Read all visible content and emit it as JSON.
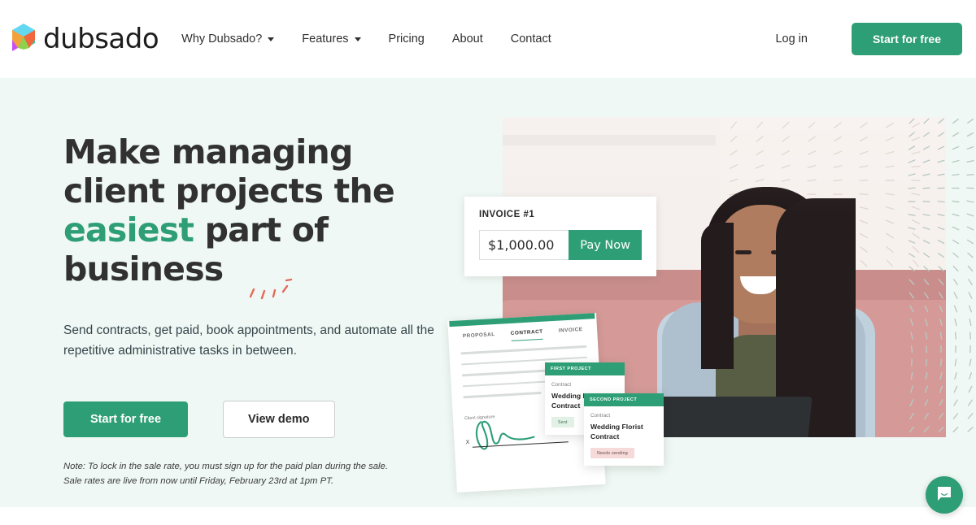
{
  "brand": {
    "name": "dubsado",
    "logo_icon": "dubsado-cube-logo"
  },
  "nav": {
    "items": [
      {
        "label": "Why Dubsado?",
        "has_caret": true
      },
      {
        "label": "Features",
        "has_caret": true
      },
      {
        "label": "Pricing",
        "has_caret": false
      },
      {
        "label": "About",
        "has_caret": false
      },
      {
        "label": "Contact",
        "has_caret": false
      }
    ],
    "login_label": "Log in",
    "cta_label": "Start for free"
  },
  "hero": {
    "headline_part1": "Make managing client projects the ",
    "headline_highlight": "easiest",
    "headline_part2": " part of business",
    "subhead": "Send contracts, get paid, book appointments, and automate all the repetitive administrative tasks in between.",
    "primary_cta": "Start for free",
    "secondary_cta": "View demo",
    "note_line1": "Note: To lock in the sale rate, you must sign up for the paid plan during the sale.",
    "note_line2": "Sale rates are live from now until Friday, February 23rd at 1pm PT.",
    "accent_green": "#2e9e76",
    "background": "#eff8f4",
    "spark_color": "#e56a5a"
  },
  "visual": {
    "invoice": {
      "title": "INVOICE #1",
      "amount": "$1,000.00",
      "pay_label": "Pay Now"
    },
    "document": {
      "tabs": [
        "PROPOSAL",
        "CONTRACT",
        "INVOICE"
      ],
      "active_tab": "CONTRACT",
      "signature_label": "Client signature",
      "signature_x": "X"
    },
    "projects": [
      {
        "header": "FIRST PROJECT",
        "kicker": "Contract",
        "title": "Wedding Florist Contract",
        "badge": "Sent",
        "badge_style": "sent"
      },
      {
        "header": "SECOND PROJECT",
        "kicker": "Contract",
        "title": "Wedding Florist Contract",
        "badge": "Needs sending",
        "badge_style": "needs"
      }
    ]
  },
  "support": {
    "chat_icon": "chat-bubble-icon"
  }
}
